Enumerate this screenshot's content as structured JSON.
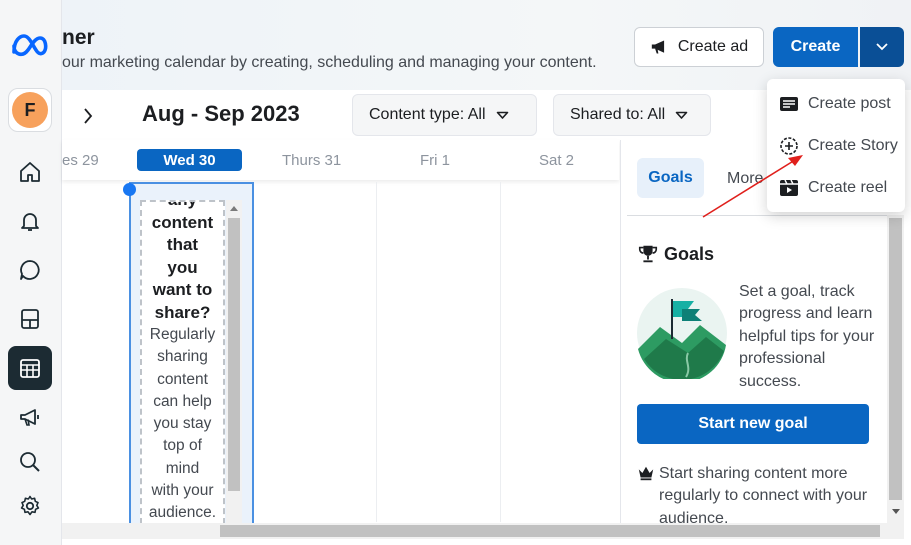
{
  "header": {
    "title": "ner",
    "subtitle": "our marketing calendar by creating, scheduling and managing your content.",
    "create_ad_label": "Create ad",
    "create_label": "Create"
  },
  "profile": {
    "initial": "F"
  },
  "toolbar": {
    "date_range": "Aug - Sep 2023",
    "content_type_filter": "Content type: All",
    "shared_to_filter": "Shared to: All"
  },
  "calendar": {
    "days": [
      "es 29",
      "Wed 30",
      "Thurs 31",
      "Fri 1",
      "Sat 2"
    ],
    "tip_heading": [
      "any",
      "content",
      "that",
      "you",
      "want to",
      "share?"
    ],
    "tip_body": [
      "Regularly",
      "sharing",
      "content",
      "can help",
      "you stay",
      "top of",
      "mind",
      "with your",
      "audience."
    ]
  },
  "panel": {
    "tabs": [
      "Goals",
      "More"
    ],
    "goals_heading": "Goals",
    "goals_description": "Set a goal, track progress and learn helpful tips for your professional success.",
    "start_goal_label": "Start new goal",
    "tip_text": "Start sharing content more regularly to connect with your audience."
  },
  "create_menu": {
    "items": [
      "Create post",
      "Create Story",
      "Create reel"
    ]
  },
  "colors": {
    "primary": "#0a66c2",
    "rail_active": "#1c2b33",
    "annotation_arrow": "#e0201c",
    "avatar": "#f7a15c"
  },
  "icons": {
    "rail": [
      "home-icon",
      "bell-icon",
      "chat-icon",
      "posts-icon",
      "calendar-icon",
      "megaphone-icon",
      "search-icon",
      "gear-icon"
    ]
  }
}
